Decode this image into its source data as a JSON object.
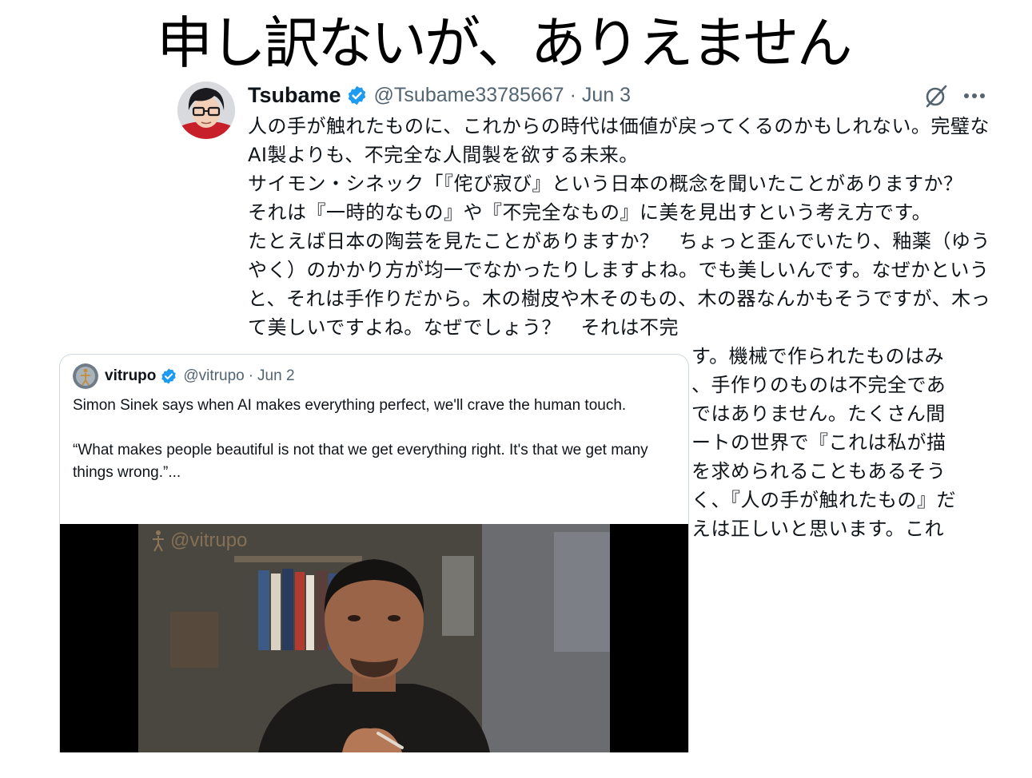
{
  "headline": "申し訳ないが、ありえません",
  "tweet": {
    "author_name": "Tsubame",
    "handle": "@Tsubame33785667",
    "separator": "·",
    "date": "Jun 3",
    "icons": {
      "verified": "verified-badge-icon",
      "grok": "grok-icon",
      "more": "more-options-icon"
    },
    "paragraphs": [
      "人の手が触れたものに、これからの時代は価値が戻ってくるのかもしれない。完璧なAI製よりも、不完全な人間製を欲する未来。",
      "サイモン・シネック「『侘び寂び』という日本の概念を聞いたことがありますか？　それは『一時的なもの』や『不完全なもの』に美を見出すという考え方です。",
      "たとえば日本の陶芸を見たことがありますか？　ちょっと歪んでいたり、釉薬（ゆうやく）のかかり方が均一でなかったりしますよね。でも美しいんです。なぜかというと、それは手作りだから。木の樹皮や木そのもの、木の器なんかもそうですが、木って美しいですよね。なぜでしょう？　それは不完",
      "す。機械で作られたものはみ",
      "、手作りのものは不完全であ",
      "ではありません。たくさん間",
      "ートの世界で『これは私が描",
      "を求められることもあるそう",
      "く、『人の手が触れたもの』だ",
      "えは正しいと思います。これ"
    ]
  },
  "quote": {
    "author_name": "vitrupo",
    "handle": "@vitrupo",
    "separator": "·",
    "date": "Jun 2",
    "text_1": "Simon Sinek says when AI makes everything perfect, we'll crave the human touch.",
    "text_2": "“What makes people beautiful is not that we get everything right. It's that we get many things wrong.”...",
    "video_watermark": "@vitrupo"
  },
  "colors": {
    "verified_blue": "#1d9bf0",
    "text": "#0f1419",
    "muted": "#536471",
    "border": "#cfd9de"
  }
}
